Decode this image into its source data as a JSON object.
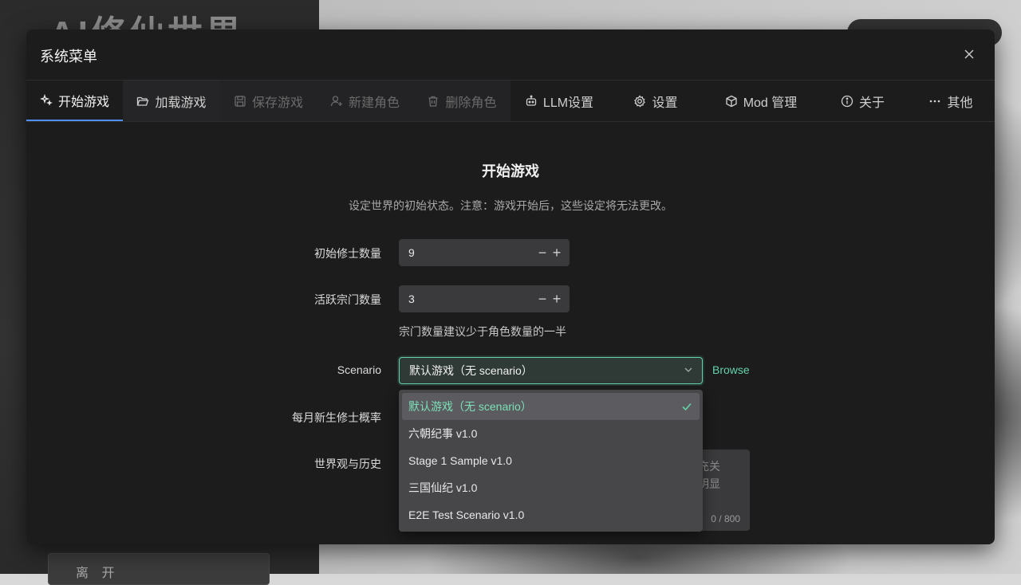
{
  "background": {
    "title": "AI修仙世界",
    "leave_label": "离 开"
  },
  "modal": {
    "title": "系统菜单",
    "close_label": "×"
  },
  "tabs": [
    {
      "label": "开始游戏",
      "icon": "sparkles-icon",
      "state": "active"
    },
    {
      "label": "加载游戏",
      "icon": "folder-open-icon",
      "state": "normal"
    },
    {
      "label": "保存游戏",
      "icon": "save-icon",
      "state": "disabled"
    },
    {
      "label": "新建角色",
      "icon": "user-plus-icon",
      "state": "disabled"
    },
    {
      "label": "删除角色",
      "icon": "trash-icon",
      "state": "disabled"
    },
    {
      "label": "LLM设置",
      "icon": "robot-icon",
      "state": "normal"
    },
    {
      "label": "设置",
      "icon": "gear-icon",
      "state": "normal"
    },
    {
      "label": "Mod 管理",
      "icon": "cube-icon",
      "state": "normal"
    },
    {
      "label": "关于",
      "icon": "info-icon",
      "state": "normal"
    },
    {
      "label": "其他",
      "icon": "ellipsis-icon",
      "state": "normal"
    }
  ],
  "start_game": {
    "title": "开始游戏",
    "description": "设定世界的初始状态。注意：游戏开始后，这些设定将无法更改。",
    "cultivators": {
      "label": "初始修士数量",
      "value": "9"
    },
    "sects": {
      "label": "活跃宗门数量",
      "value": "3",
      "hint": "宗门数量建议少于角色数量的一半"
    },
    "scenario": {
      "label": "Scenario",
      "value": "默认游戏（无 scenario）",
      "browse_label": "Browse"
    },
    "birth_rate": {
      "label": "每月新生修士概率"
    },
    "worldview": {
      "label": "世界观与历史",
      "placeholder_visible_1": "充关",
      "placeholder_visible_2": "明显",
      "counter": "0 / 800"
    }
  },
  "dropdown": {
    "options": [
      {
        "label": "默认游戏（无 scenario）",
        "selected": true
      },
      {
        "label": "六朝纪事 v1.0",
        "selected": false
      },
      {
        "label": "Stage 1 Sample v1.0",
        "selected": false
      },
      {
        "label": "三国仙纪 v1.0",
        "selected": false
      },
      {
        "label": "E2E Test Scenario v1.0",
        "selected": false
      }
    ]
  },
  "colors": {
    "accent": "#63d2a8",
    "active_tab_underline": "#4f8ff0",
    "modal_bg": "#1c1c1d"
  }
}
